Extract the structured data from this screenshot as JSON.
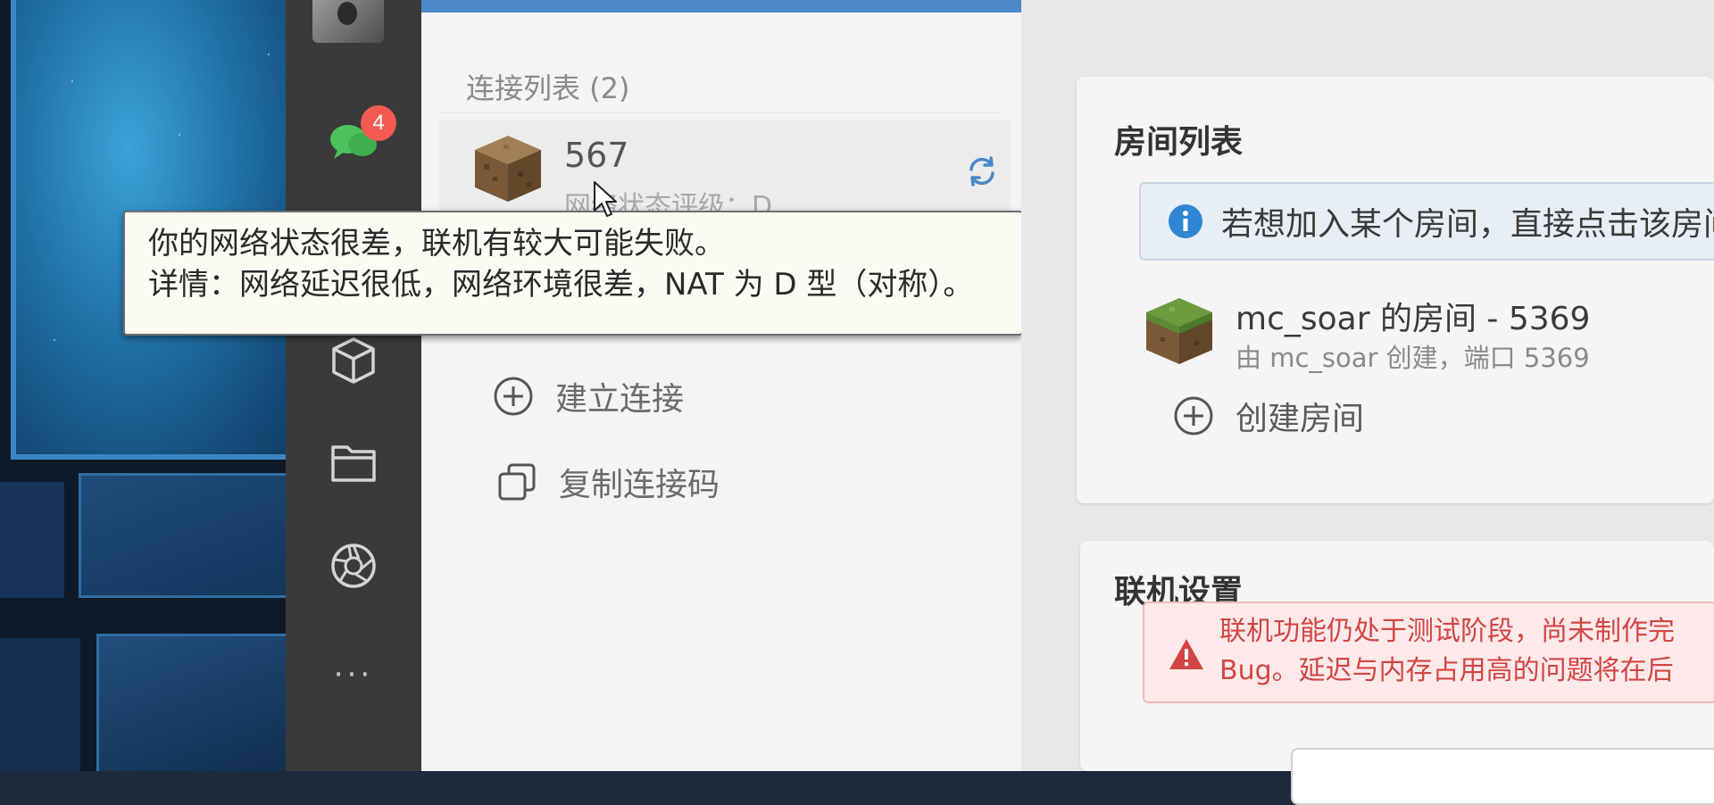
{
  "sidebar": {
    "chat_badge": "4",
    "more_label": "···"
  },
  "connections": {
    "heading": "连接列表 (2)",
    "items": [
      {
        "name": "567",
        "status": "网络状态评级：D"
      }
    ],
    "actions": {
      "create": "建立连接",
      "copy_code": "复制连接码"
    },
    "tooltip": {
      "line1": "你的网络状态很差，联机有较大可能失败。",
      "line2": "详情：网络延迟很低，网络环境很差，NAT 为 D 型（对称）。"
    }
  },
  "rooms": {
    "title": "房间列表",
    "info": "若想加入某个房间，直接点击该房间",
    "items": [
      {
        "name": "mc_soar 的房间 - 5369",
        "desc": "由 mc_soar 创建，端口 5369"
      }
    ],
    "create_label": "创建房间"
  },
  "settings": {
    "title": "联机设置",
    "warning_line1": "联机功能仍处于测试阶段，尚未制作完",
    "warning_line2": "Bug。延迟与内存占用高的问题将在后"
  },
  "colors": {
    "sidebar_bg": "#3a3a3a",
    "badge": "#f25a52",
    "info_icon": "#2e86d4",
    "warning_red": "#d24545",
    "accent_blue": "#4a88c9"
  }
}
